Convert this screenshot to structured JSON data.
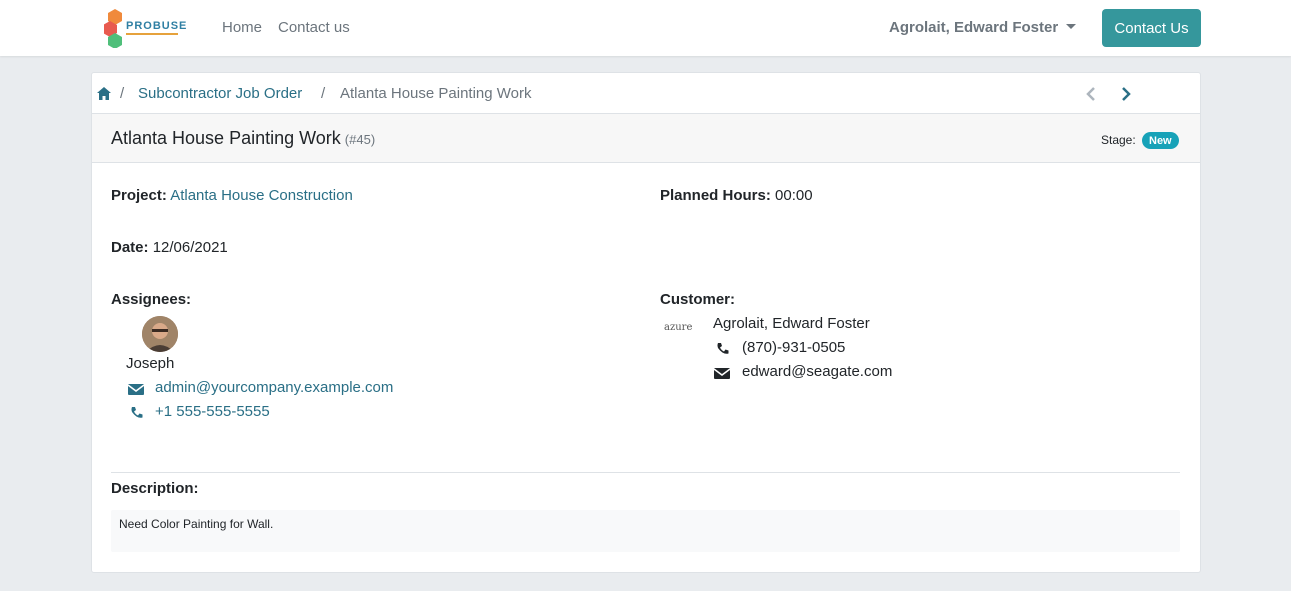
{
  "navbar": {
    "logo_text": "PROBUSE",
    "links": [
      "Home",
      "Contact us"
    ],
    "user_name": "Agrolait, Edward Foster",
    "contact_button": "Contact Us"
  },
  "breadcrumb": {
    "parent": "Subcontractor Job Order",
    "current": "Atlanta House Painting Work"
  },
  "header": {
    "title": "Atlanta House Painting Work",
    "ref": "(#45)",
    "stage_label": "Stage:",
    "stage_value": "New",
    "stage_color": "#17a2b8"
  },
  "fields": {
    "project_label": "Project:",
    "project_value": "Atlanta House Construction",
    "planned_hours_label": "Planned Hours:",
    "planned_hours_value": "00:00",
    "date_label": "Date:",
    "date_value": "12/06/2021",
    "assignees_label": "Assignees:",
    "customer_label": "Customer:"
  },
  "assignee": {
    "name": "Joseph",
    "email": "admin@yourcompany.example.com",
    "phone": "+1 555-555-5555"
  },
  "customer": {
    "logo_text": "azure",
    "name": "Agrolait, Edward Foster",
    "phone": "(870)-931-0505",
    "email": "edward@seagate.com"
  },
  "description": {
    "label": "Description:",
    "text": "Need Color Painting for Wall."
  },
  "colors": {
    "accent": "#35979c",
    "link": "#2a6f86"
  }
}
